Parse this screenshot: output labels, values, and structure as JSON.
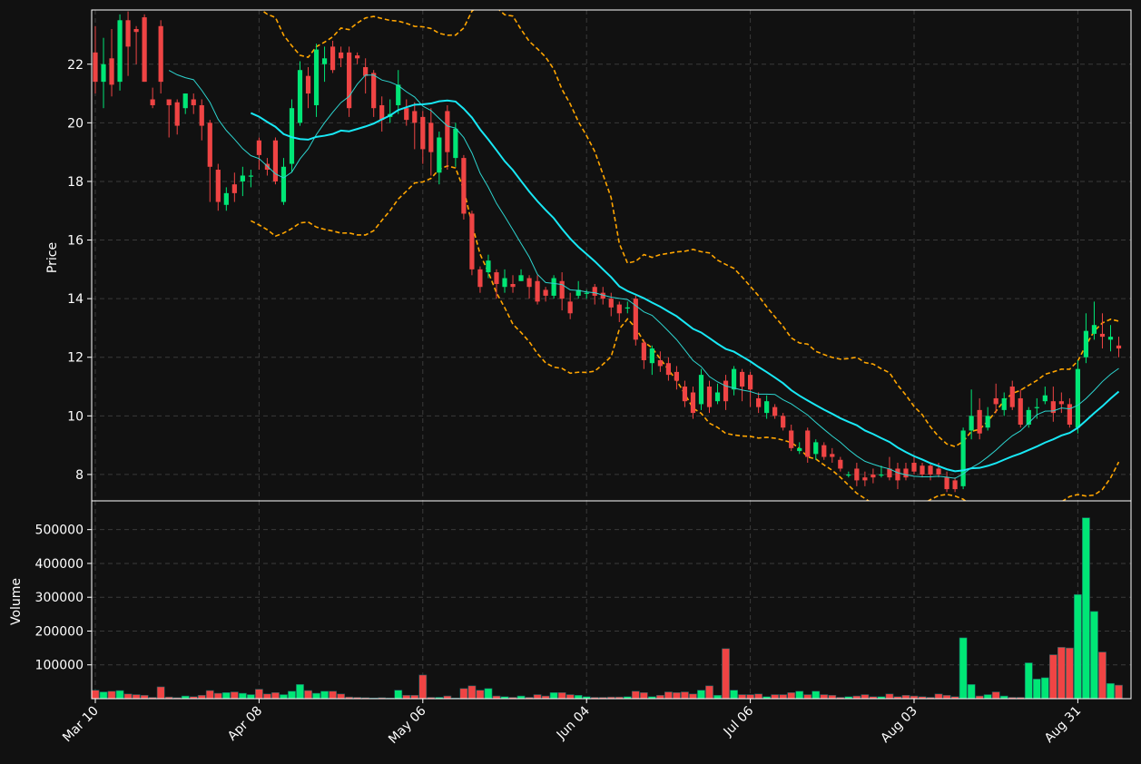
{
  "chart_data": {
    "type": "candlestick",
    "colors": {
      "background": "#111111",
      "up": "#00e676",
      "down": "#ef4444",
      "ma_fast": "#2dd4cf",
      "ma_slow": "#18e8f5",
      "bands": "#ffa500",
      "axis_text": "#ffffff",
      "grid": "#3a3a3a"
    },
    "price_panel": {
      "ylabel": "Price",
      "ylim": [
        7.1,
        23.85
      ],
      "yticks": [
        "8",
        "10",
        "12",
        "14",
        "16",
        "18",
        "20",
        "22"
      ],
      "grid": true
    },
    "volume_panel": {
      "ylabel": "Volume",
      "ylim": [
        0,
        585000
      ],
      "yticks": [
        "100000",
        "200000",
        "300000",
        "400000",
        "500000"
      ],
      "grid": true
    },
    "x_axis": {
      "tick_labels": [
        {
          "label": "Mar 10",
          "index": 0
        },
        {
          "label": "Apr 08",
          "index": 20
        },
        {
          "label": "May 06",
          "index": 40
        },
        {
          "label": "Jun 04",
          "index": 60
        },
        {
          "label": "Jul 06",
          "index": 80
        },
        {
          "label": "Aug 03",
          "index": 100
        },
        {
          "label": "Aug 31",
          "index": 120
        }
      ]
    },
    "candles": [
      [
        22.4,
        21.4,
        23.3,
        21.0,
        25000
      ],
      [
        21.4,
        22.0,
        22.9,
        20.5,
        20000
      ],
      [
        22.2,
        21.3,
        23.2,
        20.9,
        22000
      ],
      [
        21.4,
        23.5,
        23.7,
        21.1,
        24000
      ],
      [
        23.5,
        22.6,
        23.8,
        21.6,
        14000
      ],
      [
        23.2,
        23.1,
        23.3,
        22.0,
        12000
      ],
      [
        23.6,
        21.4,
        23.7,
        21.4,
        10000
      ],
      [
        20.8,
        20.6,
        21.2,
        20.5,
        4000
      ],
      [
        23.3,
        21.4,
        23.5,
        21.0,
        35000
      ],
      [
        20.8,
        20.6,
        20.4,
        19.5,
        5000
      ],
      [
        20.7,
        19.9,
        20.8,
        19.6,
        3000
      ],
      [
        20.5,
        21.0,
        21.0,
        20.3,
        8000
      ],
      [
        20.8,
        20.6,
        21.0,
        20.3,
        6000
      ],
      [
        20.6,
        19.9,
        20.8,
        19.4,
        10000
      ],
      [
        20.0,
        18.5,
        20.1,
        17.3,
        24000
      ],
      [
        18.4,
        17.3,
        18.6,
        17.0,
        16000
      ],
      [
        17.2,
        17.6,
        17.8,
        17.0,
        18000
      ],
      [
        17.9,
        17.6,
        18.3,
        17.3,
        20000
      ],
      [
        18.0,
        18.2,
        18.5,
        17.5,
        16000
      ],
      [
        18.2,
        18.2,
        18.4,
        17.8,
        12000
      ],
      [
        19.4,
        18.9,
        19.5,
        18.4,
        28000
      ],
      [
        18.6,
        18.4,
        18.8,
        18.2,
        14000
      ],
      [
        19.4,
        18.0,
        19.5,
        17.9,
        18000
      ],
      [
        17.3,
        18.5,
        18.8,
        17.2,
        12000
      ],
      [
        18.6,
        20.5,
        20.8,
        18.3,
        22000
      ],
      [
        20.0,
        21.8,
        22.1,
        19.9,
        42000
      ],
      [
        21.6,
        21.0,
        21.9,
        20.5,
        24000
      ],
      [
        20.6,
        22.5,
        22.7,
        20.2,
        16000
      ],
      [
        22.0,
        22.2,
        22.6,
        21.4,
        22000
      ],
      [
        22.6,
        21.8,
        22.8,
        21.7,
        22000
      ],
      [
        22.4,
        22.2,
        22.6,
        21.9,
        14000
      ],
      [
        22.4,
        20.5,
        22.6,
        20.2,
        5000
      ],
      [
        22.3,
        22.2,
        22.4,
        22.0,
        4000
      ],
      [
        21.9,
        21.6,
        22.2,
        21.0,
        3000
      ],
      [
        21.7,
        20.5,
        21.8,
        20.2,
        2000
      ],
      [
        20.6,
        20.1,
        20.9,
        19.7,
        3000
      ],
      [
        20.2,
        20.3,
        20.8,
        20.0,
        2000
      ],
      [
        20.6,
        21.3,
        21.8,
        20.3,
        25000
      ],
      [
        20.5,
        20.1,
        20.8,
        19.9,
        10000
      ],
      [
        20.4,
        20.0,
        20.7,
        19.1,
        10000
      ],
      [
        20.2,
        19.1,
        20.4,
        18.6,
        70000
      ],
      [
        20.0,
        19.0,
        20.5,
        18.2,
        4000
      ],
      [
        18.3,
        19.5,
        19.7,
        17.9,
        4000
      ],
      [
        20.4,
        19.0,
        20.6,
        18.4,
        8000
      ],
      [
        18.8,
        19.8,
        20.0,
        18.5,
        2000
      ],
      [
        18.8,
        16.9,
        18.9,
        16.7,
        30000
      ],
      [
        16.9,
        15.0,
        17.0,
        14.8,
        38000
      ],
      [
        15.0,
        14.4,
        15.1,
        14.2,
        25000
      ],
      [
        14.9,
        15.3,
        15.5,
        14.7,
        30000
      ],
      [
        14.9,
        14.5,
        15.0,
        14.0,
        8000
      ],
      [
        14.4,
        14.7,
        15.0,
        14.2,
        6000
      ],
      [
        14.5,
        14.4,
        14.8,
        14.2,
        4000
      ],
      [
        14.6,
        14.8,
        15.0,
        14.6,
        8000
      ],
      [
        14.7,
        14.4,
        14.8,
        14.0,
        4000
      ],
      [
        14.6,
        13.9,
        14.8,
        13.8,
        12000
      ],
      [
        14.3,
        14.1,
        14.4,
        13.9,
        8000
      ],
      [
        14.1,
        14.7,
        14.8,
        14.0,
        18000
      ],
      [
        14.6,
        14.0,
        14.9,
        13.6,
        18000
      ],
      [
        13.9,
        13.5,
        14.2,
        13.3,
        12000
      ],
      [
        14.1,
        14.3,
        14.6,
        14.0,
        10000
      ],
      [
        14.2,
        14.2,
        14.3,
        14.0,
        6000
      ],
      [
        14.4,
        14.1,
        14.5,
        13.8,
        4000
      ],
      [
        14.2,
        14.0,
        14.4,
        13.8,
        4000
      ],
      [
        14.0,
        13.7,
        14.2,
        13.4,
        5000
      ],
      [
        13.8,
        13.5,
        13.9,
        13.2,
        5000
      ],
      [
        13.7,
        13.7,
        13.9,
        13.5,
        6000
      ],
      [
        14.0,
        12.6,
        14.1,
        12.4,
        22000
      ],
      [
        12.5,
        11.9,
        12.6,
        11.6,
        18000
      ],
      [
        11.8,
        12.3,
        12.4,
        11.4,
        6000
      ],
      [
        11.9,
        11.7,
        12.2,
        11.5,
        10000
      ],
      [
        11.8,
        11.4,
        12.0,
        11.2,
        20000
      ],
      [
        11.5,
        11.2,
        11.7,
        10.9,
        18000
      ],
      [
        11.0,
        10.5,
        11.2,
        10.3,
        20000
      ],
      [
        10.8,
        10.1,
        11.0,
        9.9,
        14000
      ],
      [
        10.4,
        11.4,
        11.6,
        10.2,
        25000
      ],
      [
        11.0,
        10.3,
        11.2,
        10.1,
        38000
      ],
      [
        10.5,
        10.8,
        11.1,
        10.4,
        10000
      ],
      [
        11.2,
        10.5,
        11.4,
        10.2,
        148000
      ],
      [
        10.9,
        11.6,
        11.7,
        10.7,
        25000
      ],
      [
        11.5,
        11.0,
        11.6,
        10.5,
        12000
      ],
      [
        11.4,
        10.9,
        11.5,
        10.3,
        12000
      ],
      [
        10.6,
        10.3,
        10.8,
        10.1,
        14000
      ],
      [
        10.1,
        10.5,
        10.7,
        9.9,
        6000
      ],
      [
        10.3,
        10.0,
        10.4,
        9.9,
        12000
      ],
      [
        10.0,
        9.6,
        10.1,
        9.5,
        12000
      ],
      [
        9.5,
        8.9,
        9.7,
        8.8,
        18000
      ],
      [
        8.8,
        8.9,
        9.1,
        8.7,
        22000
      ],
      [
        9.5,
        8.6,
        9.6,
        8.4,
        12000
      ],
      [
        8.7,
        9.1,
        9.2,
        8.5,
        22000
      ],
      [
        9.0,
        8.6,
        9.1,
        8.5,
        12000
      ],
      [
        8.7,
        8.6,
        8.9,
        8.4,
        10000
      ],
      [
        8.5,
        8.2,
        8.6,
        8.1,
        4000
      ],
      [
        8.0,
        8.0,
        8.1,
        7.9,
        6000
      ],
      [
        8.2,
        7.8,
        8.4,
        7.6,
        8000
      ],
      [
        7.9,
        7.8,
        8.1,
        7.6,
        12000
      ],
      [
        8.0,
        7.9,
        8.2,
        7.7,
        6000
      ],
      [
        8.0,
        8.0,
        8.3,
        7.9,
        6000
      ],
      [
        8.2,
        7.9,
        8.6,
        7.8,
        14000
      ],
      [
        8.2,
        7.8,
        8.4,
        7.5,
        6000
      ],
      [
        8.2,
        7.9,
        8.4,
        7.8,
        10000
      ],
      [
        8.4,
        8.1,
        8.6,
        8.0,
        8000
      ],
      [
        8.3,
        8.0,
        8.4,
        7.9,
        6000
      ],
      [
        8.3,
        8.0,
        8.4,
        7.8,
        4000
      ],
      [
        8.2,
        8.0,
        8.4,
        7.9,
        14000
      ],
      [
        7.9,
        7.5,
        8.1,
        7.4,
        10000
      ],
      [
        7.8,
        7.5,
        7.9,
        7.4,
        6000
      ],
      [
        7.6,
        9.5,
        9.6,
        7.5,
        180000
      ],
      [
        9.5,
        10.0,
        10.9,
        9.2,
        42000
      ],
      [
        10.2,
        9.4,
        10.6,
        9.2,
        8000
      ],
      [
        9.6,
        10.0,
        10.3,
        9.5,
        12000
      ],
      [
        10.6,
        10.4,
        11.1,
        10.1,
        20000
      ],
      [
        10.2,
        10.6,
        10.8,
        10.0,
        8000
      ],
      [
        11.0,
        10.3,
        11.2,
        10.2,
        4000
      ],
      [
        10.6,
        9.7,
        10.9,
        9.6,
        4000
      ],
      [
        9.7,
        10.2,
        10.3,
        9.6,
        106000
      ],
      [
        10.3,
        10.3,
        10.6,
        9.9,
        58000
      ],
      [
        10.5,
        10.7,
        11.0,
        10.4,
        62000
      ],
      [
        10.5,
        10.1,
        11.0,
        9.8,
        130000
      ],
      [
        10.5,
        10.4,
        10.8,
        10.1,
        152000
      ],
      [
        10.4,
        9.7,
        10.6,
        9.6,
        150000
      ],
      [
        9.6,
        11.6,
        11.9,
        9.4,
        308000
      ],
      [
        12.0,
        12.9,
        13.5,
        11.8,
        535000
      ],
      [
        12.8,
        13.1,
        13.9,
        12.6,
        258000
      ],
      [
        12.8,
        12.7,
        13.5,
        12.3,
        138000
      ],
      [
        12.6,
        12.7,
        13.1,
        12.2,
        45000
      ],
      [
        12.4,
        12.3,
        12.7,
        12.0,
        40000
      ]
    ]
  }
}
